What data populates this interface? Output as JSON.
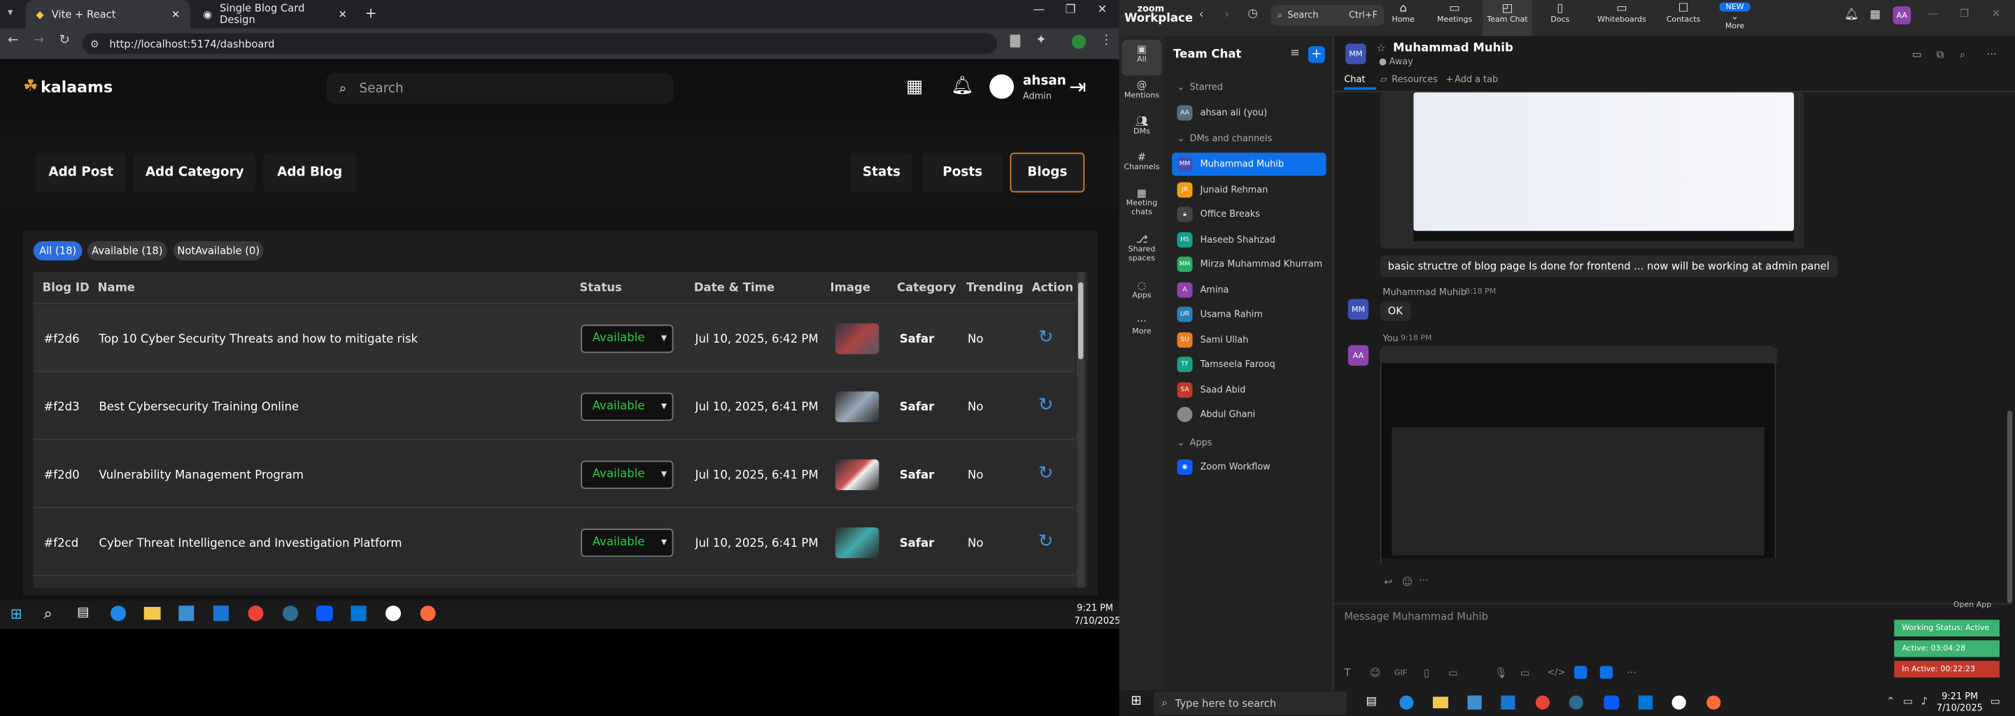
{
  "browser": {
    "tabs": [
      {
        "title": "Vite + React"
      },
      {
        "title": "Single Blog Card Design"
      }
    ],
    "url": "http://localhost:5174/dashboard"
  },
  "app": {
    "logo": "kalaams",
    "search_placeholder": "Search",
    "user_name": "ahsan",
    "user_role": "Admin"
  },
  "actions": {
    "left": [
      "Add Post",
      "Add Category",
      "Add Blog"
    ],
    "right": [
      "Stats",
      "Posts",
      "Blogs"
    ]
  },
  "filters": [
    "All (18)",
    "Available (18)",
    "NotAvailable (0)"
  ],
  "table": {
    "headers": [
      "Blog ID",
      "Name",
      "Status",
      "Date & Time",
      "Image",
      "Category",
      "Trending",
      "Action"
    ],
    "rows": [
      {
        "id": "#f2d6",
        "name": "Top 10 Cyber Security Threats and how to mitigate risk",
        "status": "Available",
        "date": "Jul 10, 2025, 6:42 PM",
        "category": "Safar",
        "trending": "No"
      },
      {
        "id": "#f2d3",
        "name": "Best Cybersecurity Training Online",
        "status": "Available",
        "date": "Jul 10, 2025, 6:41 PM",
        "category": "Safar",
        "trending": "No"
      },
      {
        "id": "#f2d0",
        "name": "Vulnerability Management Program",
        "status": "Available",
        "date": "Jul 10, 2025, 6:41 PM",
        "category": "Safar",
        "trending": "No"
      },
      {
        "id": "#f2cd",
        "name": "Cyber Threat Intelligence and Investigation Platform",
        "status": "Available",
        "date": "Jul 10, 2025, 6:41 PM",
        "category": "Safar",
        "trending": "No"
      }
    ]
  },
  "left_clock": {
    "time": "9:21 PM",
    "date": "7/10/2025"
  },
  "zoom": {
    "brand1": "zoom",
    "brand2": "Workplace",
    "search": "Search",
    "search_shortcut": "Ctrl+F",
    "nav": [
      "Home",
      "Meetings",
      "Team Chat",
      "Docs",
      "Whiteboards",
      "Contacts",
      "More"
    ],
    "new_badge": "NEW",
    "avatar": "AA",
    "rail": [
      "All",
      "Mentions",
      "DMs",
      "Channels",
      "Meeting chats",
      "Shared spaces",
      "Apps",
      "More"
    ],
    "panel_title": "Team Chat",
    "starred": "Starred",
    "me": "ahsan ali (you)",
    "dms_header": "DMs and channels",
    "contacts": [
      "Muhammad Muhib",
      "Junaid Rehman",
      "Office Breaks",
      "Haseeb Shahzad",
      "Mirza Muhammad Khurram",
      "Amina",
      "Usama Rahim",
      "Sami Ullah",
      "Tamseela Farooq",
      "Saad Abid",
      "Abdul Ghani"
    ],
    "contact_initials": [
      "MM",
      "JR",
      "",
      "HS",
      "MM",
      "A",
      "UR",
      "SU",
      "TF",
      "SA",
      ""
    ],
    "apps_header": "Apps",
    "app_item": "Zoom Workflow",
    "chat_name": "Muhammad Muhib",
    "chat_status": "Away",
    "chat_initials": "MM",
    "tabs": [
      "Chat",
      "Resources",
      "Add a tab"
    ],
    "msg1": "basic structre of blog page Is done for frontend ... now will be working at admin panel",
    "msg2_meta": "Muhammad Muhib",
    "msg2_time": "8:18 PM",
    "msg2": "OK",
    "msg3_meta": "You",
    "msg3_time": "9:18 PM",
    "composer_placeholder": "Message Muhammad Muhib",
    "open_app": "Open App",
    "status_working": "Working Status: Active",
    "status_active": "Active: 03:04:28",
    "status_inactive": "In Active: 00:22:23",
    "task_search": "Type here to search",
    "clock_time": "9:21 PM",
    "clock_date": "7/10/2025"
  },
  "colors": {
    "accent_blue": "#0e71eb",
    "zoom_blue": "#2d6cdf",
    "orange": "#d97b2a",
    "green": "#2ecc40",
    "status_green": "#3cb371",
    "status_red": "#c0392b"
  }
}
